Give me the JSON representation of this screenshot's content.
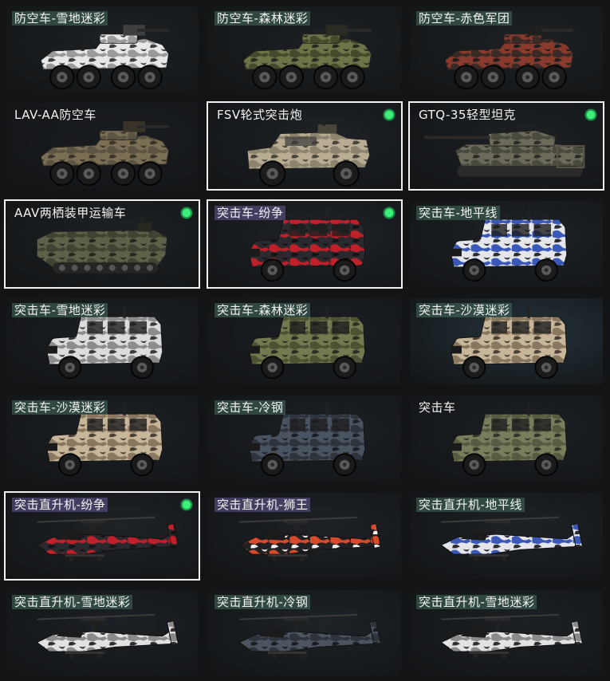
{
  "cards": [
    {
      "name": "防空车-雪地迷彩",
      "tag": "green",
      "type": "aa",
      "camo": [
        "#e8e8e8",
        "#9a9a9a",
        "#3f3f3f"
      ],
      "selected": false,
      "equipped": false,
      "bg": "#1e2224"
    },
    {
      "name": "防空车-森林迷彩",
      "tag": "green",
      "type": "aa",
      "camo": [
        "#6e7448",
        "#454a2c",
        "#2b2b22"
      ],
      "selected": false,
      "equipped": false,
      "bg": "#1d2123"
    },
    {
      "name": "防空车-赤色军团",
      "tag": "green",
      "type": "aa",
      "camo": [
        "#8a3a2c",
        "#3a2a26",
        "#1f1f1f"
      ],
      "selected": false,
      "equipped": false,
      "bg": "#1e2224"
    },
    {
      "name": "LAV-AA防空车",
      "tag": "none",
      "type": "aa",
      "camo": [
        "#7a6f55",
        "#5c5442",
        "#3a3428"
      ],
      "selected": false,
      "equipped": false,
      "bg": "#1a1d20"
    },
    {
      "name": "FSV轮式突击炮",
      "tag": "none",
      "type": "fsv",
      "camo": [
        "#b8ad93",
        "#8d8470",
        "#4a453a"
      ],
      "selected": true,
      "equipped": true,
      "bg": "#1f2326"
    },
    {
      "name": "GTQ-35轻型坦克",
      "tag": "none",
      "type": "tank",
      "camo": [
        "#6c6a5a",
        "#4a493e",
        "#2c2b26"
      ],
      "selected": true,
      "equipped": true,
      "bg": "#1d2124"
    },
    {
      "name": "AAV两栖装甲运输车",
      "tag": "none",
      "type": "aav",
      "camo": [
        "#5c6248",
        "#3f4432",
        "#25281f"
      ],
      "selected": true,
      "equipped": true,
      "bg": "#1e2224"
    },
    {
      "name": "突击车-纷争",
      "tag": "purple",
      "type": "truck",
      "camo": [
        "#2a2a2e",
        "#c0202a",
        "#141416"
      ],
      "selected": true,
      "equipped": true,
      "bg": "#202428"
    },
    {
      "name": "突击车-地平线",
      "tag": "green",
      "type": "truck",
      "camo": [
        "#e4e6ea",
        "#3a58b8",
        "#2a2c30"
      ],
      "selected": false,
      "equipped": false,
      "bg": "#1f2327"
    },
    {
      "name": "突击车-雪地迷彩",
      "tag": "green",
      "type": "truck",
      "camo": [
        "#dcdcdc",
        "#8c8c8c",
        "#3a3a3a"
      ],
      "selected": false,
      "equipped": false,
      "bg": "#1c2024"
    },
    {
      "name": "突击车-森林迷彩",
      "tag": "green",
      "type": "truck",
      "camo": [
        "#747a50",
        "#4c5232",
        "#2a2c22"
      ],
      "selected": false,
      "equipped": false,
      "bg": "#1c2024"
    },
    {
      "name": "突击车-沙漠迷彩",
      "tag": "green",
      "type": "truck",
      "camo": [
        "#c8b69a",
        "#8a7760",
        "#4a4034"
      ],
      "selected": false,
      "equipped": false,
      "bg": "#24323a"
    },
    {
      "name": "突击车-沙漠迷彩",
      "tag": "green",
      "type": "truck",
      "camo": [
        "#c8b69a",
        "#8a7760",
        "#4a4034"
      ],
      "selected": false,
      "equipped": false,
      "bg": "#1d2125"
    },
    {
      "name": "突击车-冷钢",
      "tag": "green",
      "type": "truck",
      "camo": [
        "#4a5360",
        "#2e343c",
        "#1c2026"
      ],
      "selected": false,
      "equipped": false,
      "bg": "#1d2125"
    },
    {
      "name": "突击车",
      "tag": "none",
      "type": "truck",
      "camo": [
        "#7a7d5c",
        "#585b42",
        "#33352a"
      ],
      "selected": false,
      "equipped": false,
      "bg": "#1d2125"
    },
    {
      "name": "突击直升机-纷争",
      "tag": "purple",
      "type": "heli",
      "camo": [
        "#2a2a2e",
        "#c0202a",
        "#151517"
      ],
      "selected": true,
      "equipped": true,
      "bg": "#1f2326"
    },
    {
      "name": "突击直升机-狮王",
      "tag": "purple",
      "type": "heli",
      "camo": [
        "#202022",
        "#d84a2a",
        "#f0f0f0"
      ],
      "selected": false,
      "equipped": false,
      "bg": "#1e2226"
    },
    {
      "name": "突击直升机-地平线",
      "tag": "green",
      "type": "heli",
      "camo": [
        "#e4e6ea",
        "#3a58b8",
        "#2a2c30"
      ],
      "selected": false,
      "equipped": false,
      "bg": "#1e2226"
    },
    {
      "name": "突击直升机-雪地迷彩",
      "tag": "green",
      "type": "heli",
      "camo": [
        "#e2e2e2",
        "#8a8a8a",
        "#2e2e2e"
      ],
      "selected": false,
      "equipped": false,
      "bg": "#1d2125"
    },
    {
      "name": "突击直升机-冷钢",
      "tag": "green",
      "type": "heli",
      "camo": [
        "#4c5460",
        "#2e343c",
        "#1a1d22"
      ],
      "selected": false,
      "equipped": false,
      "bg": "#1e2327"
    },
    {
      "name": "突击直升机-雪地迷彩",
      "tag": "green",
      "type": "heli",
      "camo": [
        "#e2e2e2",
        "#8a8a8a",
        "#2e2e2e"
      ],
      "selected": false,
      "equipped": false,
      "bg": "#1d2125"
    }
  ]
}
